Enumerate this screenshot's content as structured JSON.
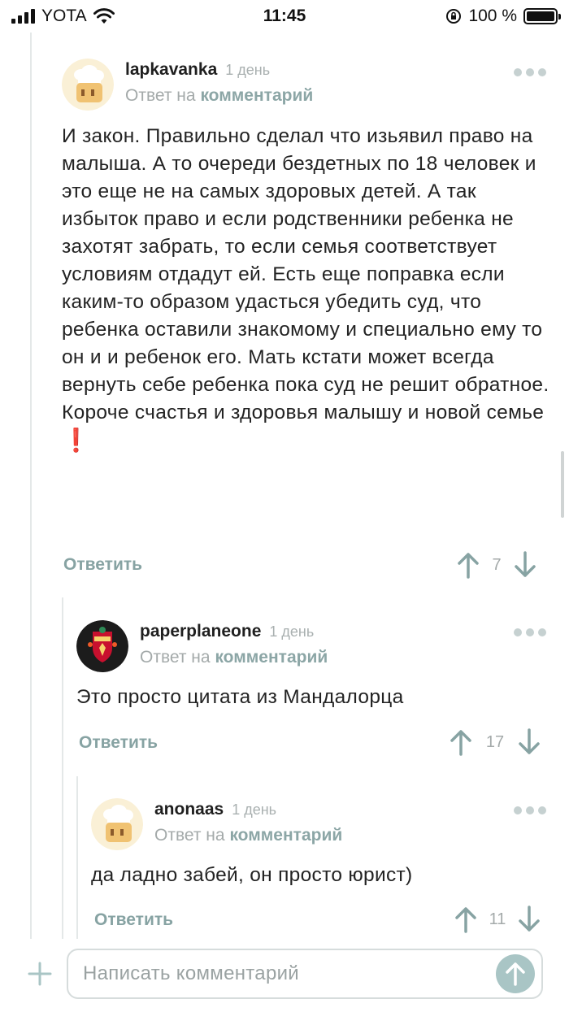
{
  "status_bar": {
    "carrier": "YOTA",
    "time": "11:45",
    "battery": "100 %",
    "battery_level": 1.0,
    "signal_icon": "cellular-signal-icon",
    "wifi_icon": "wifi-icon",
    "lock_icon": "orientation-lock-icon"
  },
  "comments": [
    {
      "username": "lapkavanka",
      "time": "1 день",
      "reply_prefix": "Ответ на",
      "reply_link": "комментарий",
      "text": "И закон. Правильно сделал что изьявил право на малыша. А то очереди бездетных по 18 человек и это еще не на самых здоровых детей. А так избыток право и если родственники ребенка не захотят забрать, то если семья соответствует условиям отдадут ей. Есть еще поправка если каким-то образом удасться убедить суд, что ребенка оставили знакомому и специально ему то он и и ребенок его. Мать кстати может всегда вернуть себе ребенка пока суд не решит обратное. Короче счастья и здоровья малышу и новой семье",
      "emoji": "❗",
      "reply_label": "Ответить",
      "rating": "7",
      "avatar_icon": "chef-toast-avatar-icon"
    },
    {
      "username": "paperplaneone",
      "time": "1 день",
      "reply_prefix": "Ответ на",
      "reply_link": "комментарий",
      "text": "Это просто цитата из Мандалорца",
      "reply_label": "Ответить",
      "rating": "17",
      "avatar_icon": "liverpool-crest-avatar-icon"
    },
    {
      "username": "anonaas",
      "time": "1 день",
      "reply_prefix": "Ответ на",
      "reply_link": "комментарий",
      "text": "да ладно забей, он просто юрист)",
      "reply_label": "Ответить",
      "rating": "11",
      "avatar_icon": "chef-toast-avatar-icon"
    }
  ],
  "composer": {
    "placeholder": "Написать комментарий",
    "plus_icon": "plus-icon",
    "send_icon": "arrow-up-icon"
  },
  "colors": {
    "accent": "#87a3a3",
    "muted": "#a4aaaa",
    "send_button": "#a9c5c5"
  }
}
